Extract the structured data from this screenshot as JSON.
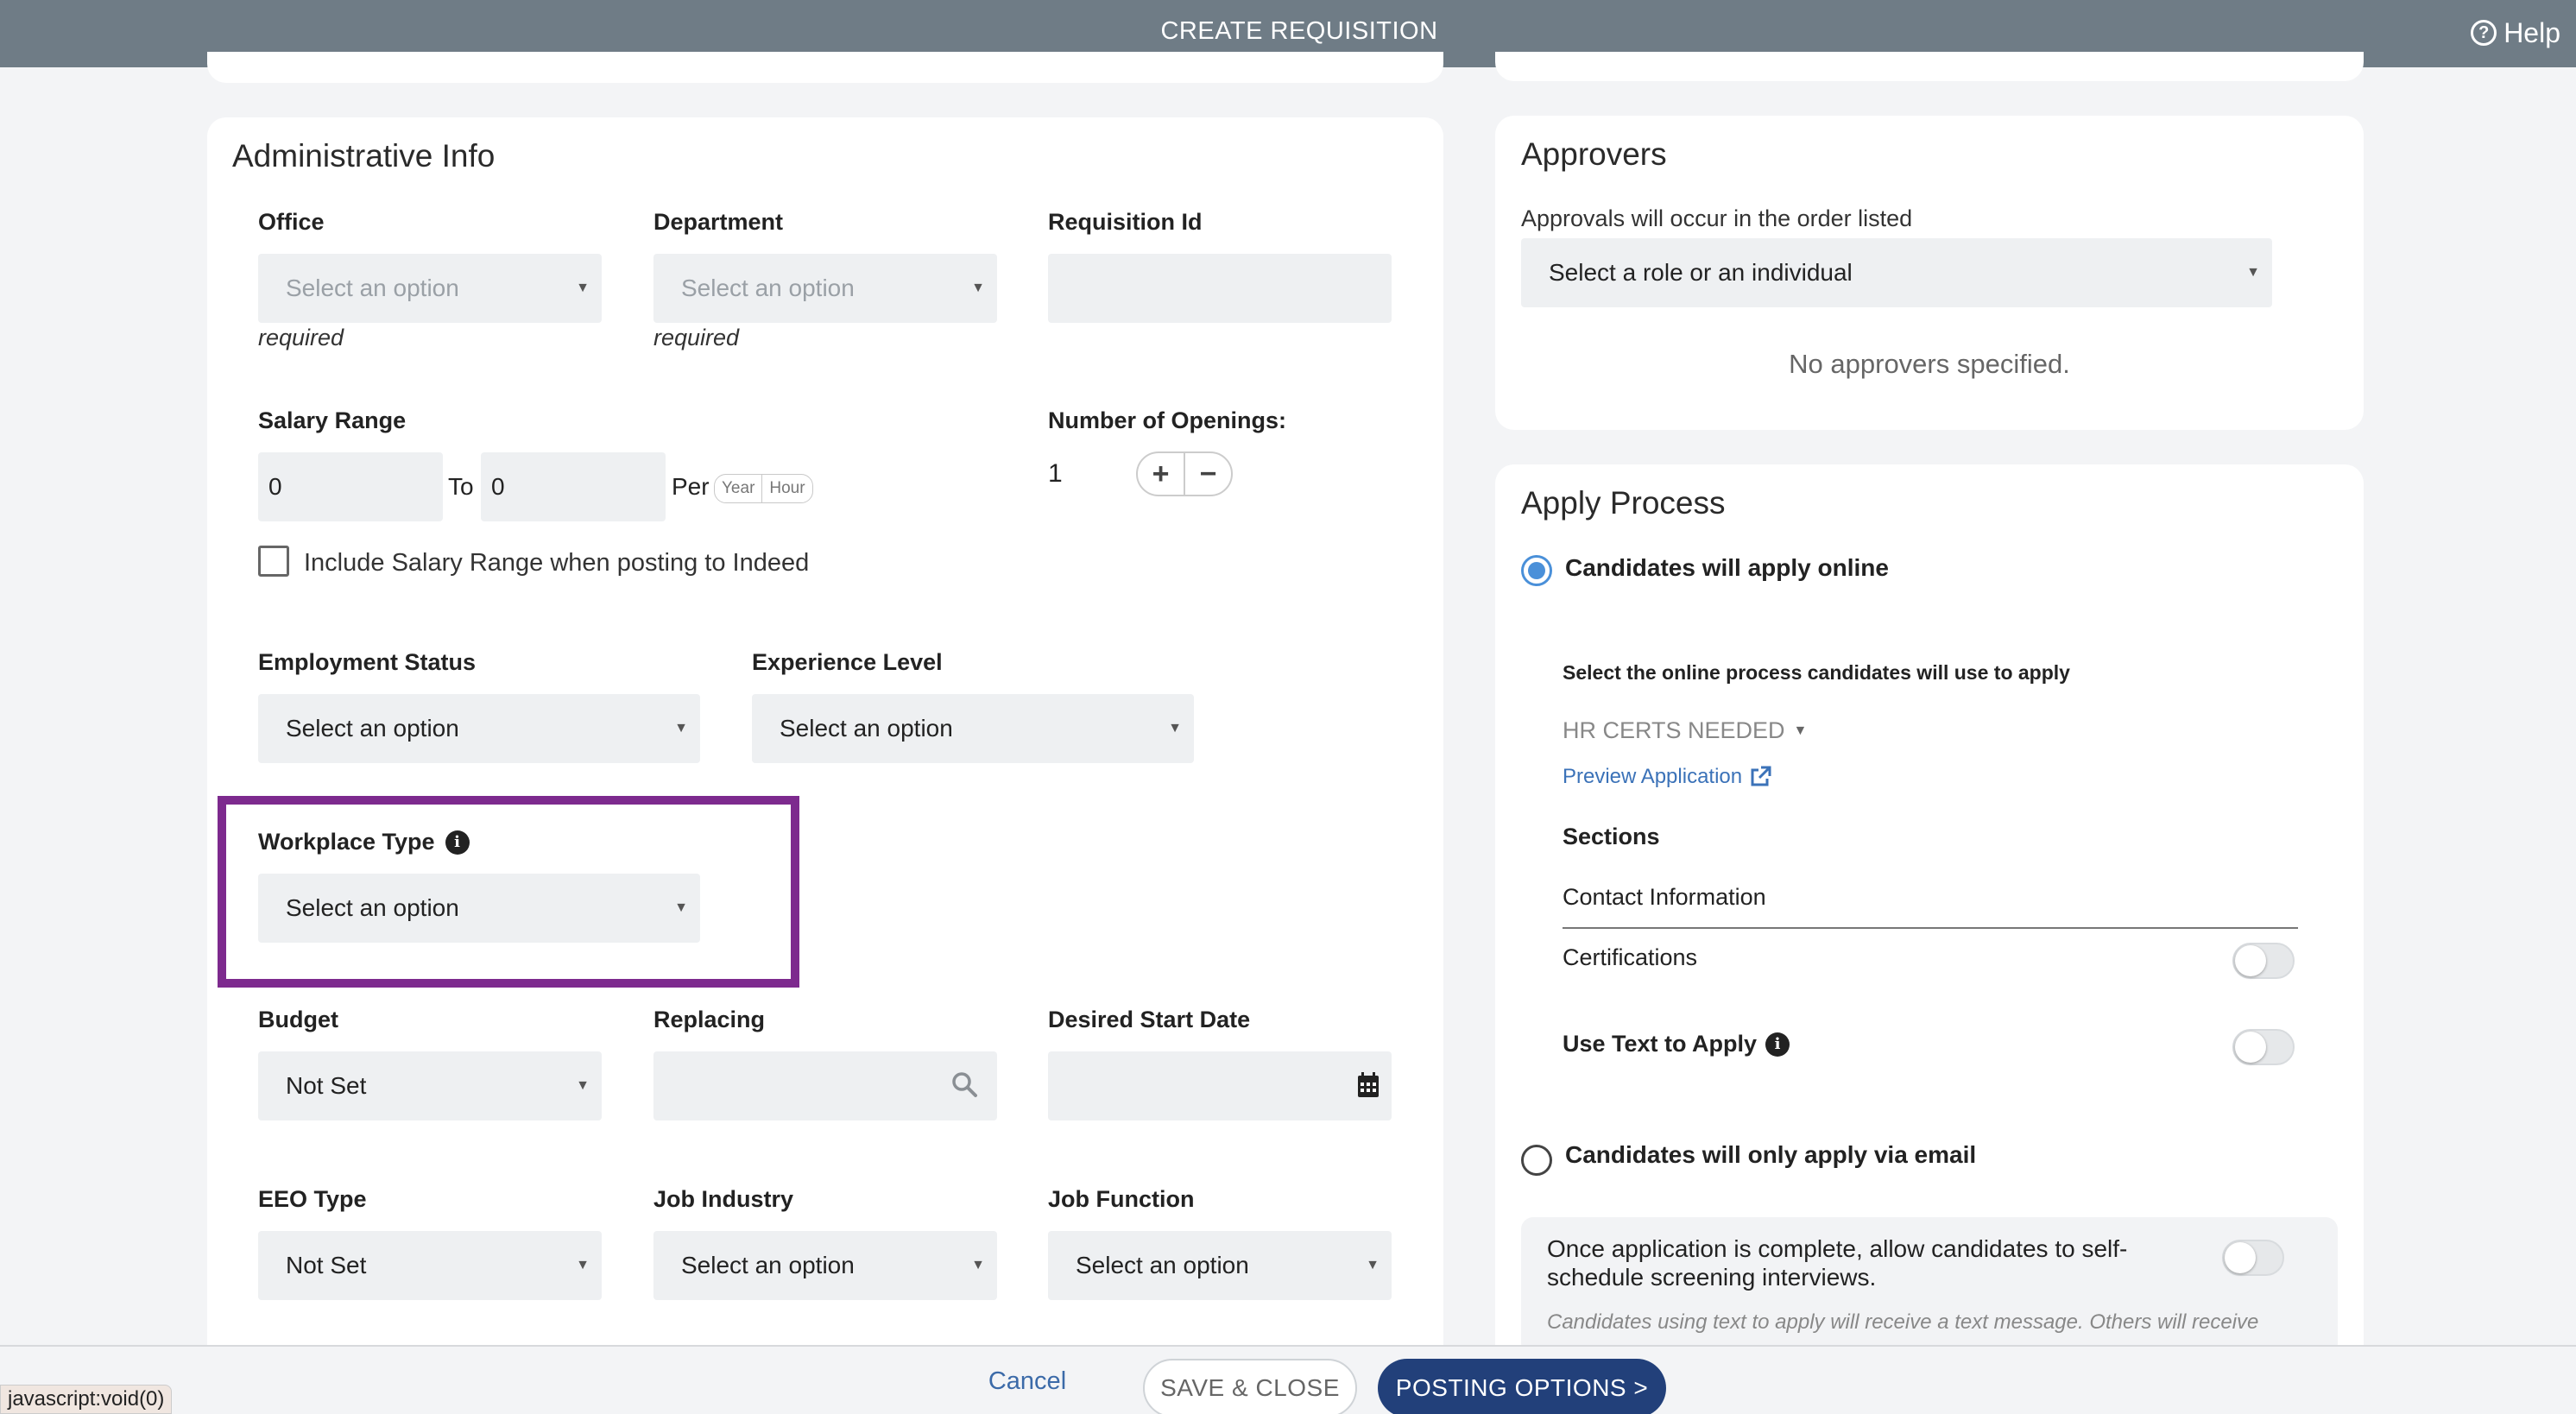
{
  "header": {
    "title": "CREATE REQUISITION",
    "help_label": "Help"
  },
  "admin": {
    "title": "Administrative Info",
    "office": {
      "label": "Office",
      "value": "Select an option",
      "hint": "required"
    },
    "department": {
      "label": "Department",
      "value": "Select an option",
      "hint": "required"
    },
    "requisition_id": {
      "label": "Requisition Id",
      "value": ""
    },
    "salary": {
      "label": "Salary Range",
      "from": "0",
      "to_label": "To",
      "to": "0",
      "per_label": "Per",
      "per_options": [
        "Year",
        "Hour"
      ],
      "indeed_checkbox_label": "Include Salary Range when posting to Indeed"
    },
    "openings": {
      "label": "Number of Openings:",
      "value": "1"
    },
    "employment_status": {
      "label": "Employment Status",
      "value": "Select an option"
    },
    "experience_level": {
      "label": "Experience Level",
      "value": "Select an option"
    },
    "workplace_type": {
      "label": "Workplace Type",
      "value": "Select an option"
    },
    "budget": {
      "label": "Budget",
      "value": "Not Set"
    },
    "replacing": {
      "label": "Replacing",
      "value": ""
    },
    "desired_start_date": {
      "label": "Desired Start Date",
      "value": ""
    },
    "eeo_type": {
      "label": "EEO Type",
      "value": "Not Set"
    },
    "job_industry": {
      "label": "Job Industry",
      "value": "Select an option"
    },
    "job_function": {
      "label": "Job Function",
      "value": "Select an option"
    }
  },
  "approvers": {
    "title": "Approvers",
    "note": "Approvals will occur in the order listed",
    "select_value": "Select a role or an individual",
    "empty_text": "No approvers specified."
  },
  "apply": {
    "title": "Apply Process",
    "online_label": "Candidates will apply online",
    "online_selected": true,
    "select_process_label": "Select the online process candidates will use to apply",
    "process_value": "HR CERTS NEEDED",
    "preview_link": "Preview Application",
    "sections_label": "Sections",
    "sections": [
      {
        "label": "Contact Information",
        "toggle": null
      },
      {
        "label": "Certifications",
        "toggle": false
      }
    ],
    "text_to_apply_label": "Use Text to Apply",
    "text_to_apply_on": false,
    "email_label": "Candidates will only apply via email",
    "self_schedule_text": "Once application is complete, allow candidates to self-schedule screening interviews.",
    "self_schedule_on": false,
    "note_text": "Candidates using text to apply will receive a text message. Others will receive"
  },
  "footer": {
    "cancel_label": "Cancel",
    "save_label": "SAVE & CLOSE",
    "posting_label": "POSTING OPTIONS >"
  },
  "statusbar": {
    "text": "javascript:void(0)"
  },
  "colors": {
    "header_bg": "#6f7c86",
    "highlight_border": "#7d2a8e",
    "primary_button": "#22407a",
    "radio_accent": "#4a90d9"
  }
}
